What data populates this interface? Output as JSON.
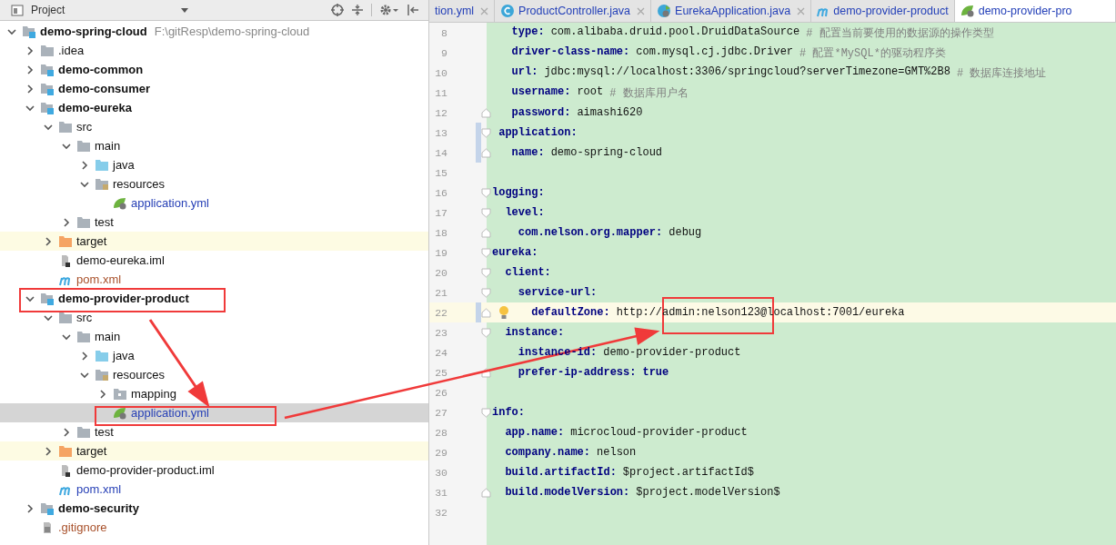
{
  "project_panel": {
    "title": "Project"
  },
  "tree": [
    {
      "name": "demo-spring-cloud",
      "path": "F:\\gitResp\\demo-spring-cloud",
      "kind": "module",
      "expanded": true,
      "selected": false,
      "children": [
        {
          "name": ".idea",
          "kind": "folder",
          "expanded": false,
          "selected": false
        },
        {
          "name": "demo-common",
          "kind": "module",
          "expanded": false,
          "selected": false
        },
        {
          "name": "demo-consumer",
          "kind": "module",
          "expanded": false,
          "selected": false
        },
        {
          "name": "demo-eureka",
          "kind": "module",
          "expanded": true,
          "selected": false,
          "children": [
            {
              "name": "src",
              "kind": "folder",
              "expanded": true,
              "selected": false,
              "children": [
                {
                  "name": "main",
                  "kind": "folder",
                  "expanded": true,
                  "selected": false,
                  "children": [
                    {
                      "name": "java",
                      "kind": "source-folder",
                      "expanded": false,
                      "selected": false
                    },
                    {
                      "name": "resources",
                      "kind": "resource-folder",
                      "expanded": true,
                      "selected": false,
                      "children": [
                        {
                          "name": "application.yml",
                          "kind": "yml",
                          "color": "#2740b6",
                          "selected": false
                        }
                      ]
                    }
                  ]
                },
                {
                  "name": "test",
                  "kind": "folder",
                  "expanded": false,
                  "selected": false
                }
              ]
            },
            {
              "name": "target",
              "kind": "output-folder",
              "expanded": false,
              "selected": false
            },
            {
              "name": "demo-eureka.iml",
              "kind": "iml",
              "selected": false
            },
            {
              "name": "pom.xml",
              "kind": "pom",
              "color": "#a8502a",
              "selected": false
            }
          ]
        },
        {
          "name": "demo-provider-product",
          "kind": "module",
          "expanded": true,
          "selected": false,
          "children": [
            {
              "name": "src",
              "kind": "folder",
              "expanded": true,
              "selected": false,
              "children": [
                {
                  "name": "main",
                  "kind": "folder",
                  "expanded": true,
                  "selected": false,
                  "children": [
                    {
                      "name": "java",
                      "kind": "source-folder",
                      "expanded": false,
                      "selected": false
                    },
                    {
                      "name": "resources",
                      "kind": "resource-folder",
                      "expanded": true,
                      "selected": false,
                      "children": [
                        {
                          "name": "mapping",
                          "kind": "package",
                          "expanded": false,
                          "selected": false
                        },
                        {
                          "name": "application.yml",
                          "kind": "yml",
                          "color": "#2740b6",
                          "selected": true
                        }
                      ]
                    }
                  ]
                },
                {
                  "name": "test",
                  "kind": "folder",
                  "expanded": false,
                  "selected": false
                }
              ]
            },
            {
              "name": "target",
              "kind": "output-folder",
              "expanded": false,
              "selected": false
            },
            {
              "name": "demo-provider-product.iml",
              "kind": "iml",
              "selected": false
            },
            {
              "name": "pom.xml",
              "kind": "pom",
              "color": "#2740b6",
              "selected": false
            }
          ]
        },
        {
          "name": "demo-security",
          "kind": "module",
          "expanded": false,
          "selected": false
        },
        {
          "name": ".gitignore",
          "kind": "text",
          "color": "#a8502a",
          "selected": false
        }
      ]
    }
  ],
  "tabs": [
    {
      "label": "tion.yml",
      "kind": "yml",
      "closable": true,
      "selected": false
    },
    {
      "label": "ProductController.java",
      "kind": "class",
      "closable": true,
      "selected": false
    },
    {
      "label": "EurekaApplication.java",
      "kind": "app",
      "closable": true,
      "selected": false
    },
    {
      "label": "demo-provider-product",
      "kind": "pom",
      "closable": false,
      "selected": false
    },
    {
      "label": "demo-provider-pro",
      "kind": "yml",
      "closable": false,
      "selected": true
    }
  ],
  "editor": {
    "lines": [
      {
        "number": "8",
        "key": "   type:",
        "value": "com.alibaba.druid.pool.DruidDataSource",
        "comment": "# 配置当前要使用的数据源的操作类型"
      },
      {
        "number": "9",
        "key": "   driver-class-name:",
        "value": "com.mysql.cj.jdbc.Driver",
        "comment": "# 配置*MySQL*的驱动程序类"
      },
      {
        "number": "10",
        "key": "   url:",
        "value": "jdbc:mysql://localhost:3306/springcloud?serverTimezone=GMT%2B8",
        "comment": "# 数据库连接地址"
      },
      {
        "number": "11",
        "key": "   username:",
        "value": "root",
        "comment": "# 数据库用户名"
      },
      {
        "number": "12",
        "key": "   password:",
        "value": "aimashi620",
        "fold_end": true
      },
      {
        "number": "13",
        "key": " application:",
        "fold_start": true,
        "changed": true
      },
      {
        "number": "14",
        "key": "   name:",
        "value": "demo-spring-cloud",
        "fold_end": true,
        "changed": true
      },
      {
        "number": "15"
      },
      {
        "number": "16",
        "key": "logging:",
        "fold_start": true
      },
      {
        "number": "17",
        "key": "  level:",
        "fold_start": true
      },
      {
        "number": "18",
        "key": "    com.nelson.org.mapper:",
        "value": "debug",
        "fold_end": true
      },
      {
        "number": "19",
        "key": "eureka:",
        "fold_start": true
      },
      {
        "number": "20",
        "key": "  client:",
        "fold_start": true
      },
      {
        "number": "21",
        "key": "    service-url:",
        "fold_start": true
      },
      {
        "number": "22",
        "key": "      defaultZone:",
        "value": "http://admin:nelson123@localhost:7001/eureka",
        "fold_end": true,
        "changed": true,
        "current": true
      },
      {
        "number": "23",
        "key": "  instance:",
        "fold_start": true
      },
      {
        "number": "24",
        "key": "    instance-id:",
        "value": "demo-provider-product"
      },
      {
        "number": "25",
        "key": "    prefer-ip-address:",
        "value": "true",
        "keyword": true,
        "fold_end": true
      },
      {
        "number": "26"
      },
      {
        "number": "27",
        "key": "info:",
        "fold_start": true
      },
      {
        "number": "28",
        "key": "  app.name:",
        "value": "microcloud-provider-product"
      },
      {
        "number": "29",
        "key": "  company.name:",
        "value": "nelson"
      },
      {
        "number": "30",
        "key": "  build.artifactId:",
        "value": "$project.artifactId$"
      },
      {
        "number": "31",
        "key": "  build.modelVersion:",
        "value": "$project.modelVersion$",
        "fold_end": true
      },
      {
        "number": "32"
      }
    ]
  }
}
